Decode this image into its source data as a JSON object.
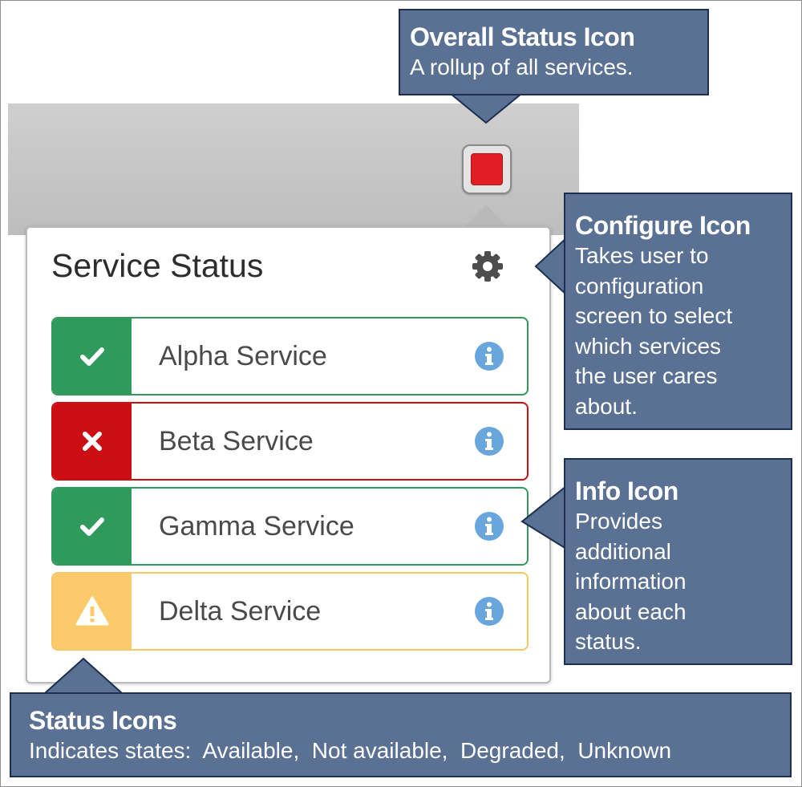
{
  "panel": {
    "title": "Service Status",
    "services": [
      {
        "name": "Alpha Service",
        "status": "available",
        "status_icon": "check-icon"
      },
      {
        "name": "Beta Service",
        "status": "not-available",
        "status_icon": "x-icon"
      },
      {
        "name": "Gamma Service",
        "status": "available",
        "status_icon": "check-icon"
      },
      {
        "name": "Delta Service",
        "status": "degraded",
        "status_icon": "warning-icon"
      }
    ]
  },
  "overall_status": {
    "state": "not-available",
    "color": "#e01e23"
  },
  "colors": {
    "available": "#2f9a5c",
    "not_available": "#cc0e12",
    "degraded": "#fbca6a",
    "info": "#6aa6de",
    "callout_bg": "#5a7194"
  },
  "callouts": {
    "overall": {
      "title": "Overall Status Icon",
      "lines": [
        "A rollup of all services."
      ]
    },
    "configure": {
      "title": "Configure Icon",
      "lines": [
        "Takes  user to",
        "configuration",
        "screen  to select",
        "which services",
        "the user cares",
        "about."
      ]
    },
    "info": {
      "title": "Info Icon",
      "lines": [
        "Provides",
        "additional",
        "information",
        "about each",
        "status."
      ]
    },
    "status": {
      "title": "Status Icons",
      "lines": [
        "Indicates states:  Available,  Not available,  Degraded,  Unknown"
      ]
    }
  }
}
